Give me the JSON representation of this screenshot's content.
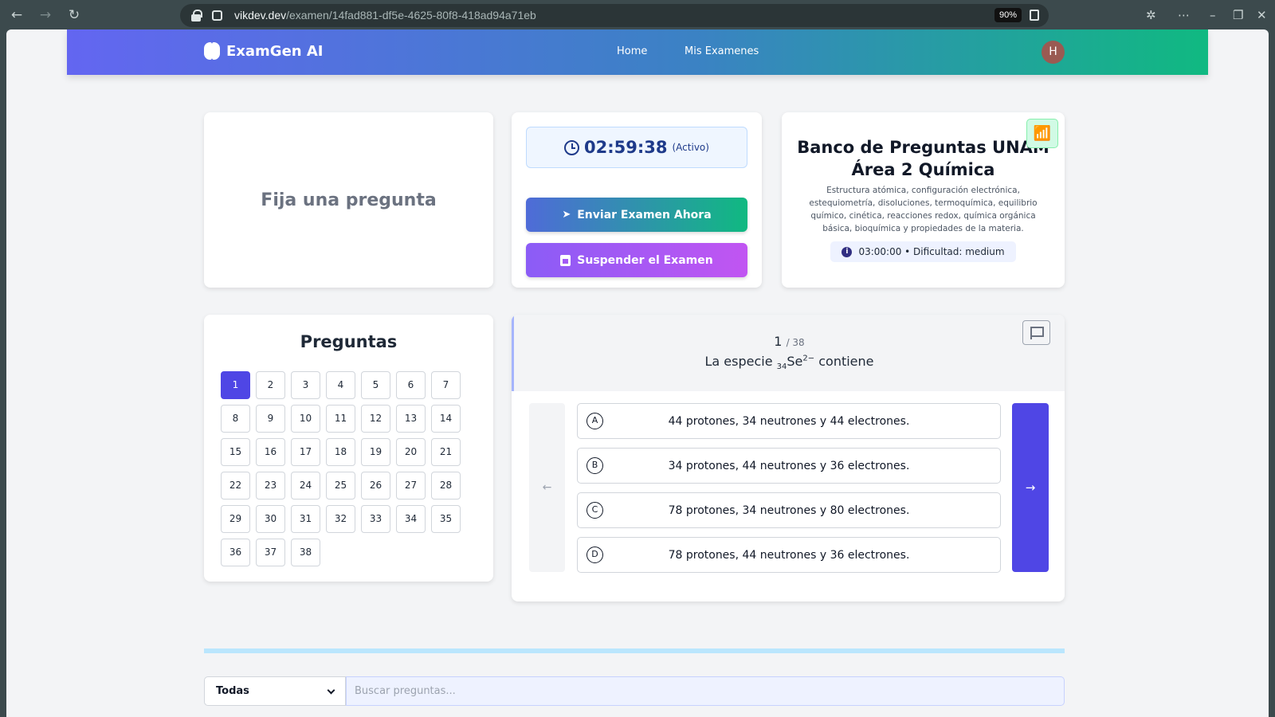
{
  "browser": {
    "url_host": "vikdev.dev",
    "url_path": "/examen/14fad881-df5e-4625-80f8-418ad94a71eb",
    "zoom": "90%"
  },
  "app": {
    "brand": "ExamGen AI",
    "nav": [
      "Home",
      "Mis Examenes"
    ],
    "avatar_initial": "H",
    "colors": {
      "gradient_start": "#6366f1",
      "gradient_end": "#10b981",
      "primary": "#4f46e5"
    }
  },
  "pin_card": {
    "text": "Fija una pregunta"
  },
  "timer": {
    "time": "02:59:38",
    "status": "(Activo)",
    "send_label": "Enviar Examen Ahora",
    "suspend_label": "Suspender el Examen"
  },
  "bank": {
    "title": "Banco de Preguntas UNAM Área 2 Química",
    "description": "Estructura atómica, configuración electrónica, estequiometría, disoluciones, termoquímica, equilibrio químico, cinética, reacciones redox, química orgánica básica, bioquímica y propiedades de la materia.",
    "meta": "03:00:00 • Dificultad: medium"
  },
  "questions_panel": {
    "title": "Preguntas",
    "total": 38,
    "active": 1
  },
  "question": {
    "number": "1",
    "total_label": "/ 38",
    "text_before": "La especie ",
    "sub": "34",
    "species": "Se",
    "sup": "2−",
    "text_after": " contiene",
    "options": [
      {
        "letter": "A",
        "text": "44 protones, 34 neutrones y 44 electrones."
      },
      {
        "letter": "B",
        "text": "34 protones, 44 neutrones y 36 electrones."
      },
      {
        "letter": "C",
        "text": "78 protones, 34 neutrones y 80 electrones."
      },
      {
        "letter": "D",
        "text": "78 protones, 44 neutrones y 36 electrones."
      }
    ]
  },
  "filter": {
    "selected": "Todas",
    "search_placeholder": "Buscar preguntas..."
  }
}
